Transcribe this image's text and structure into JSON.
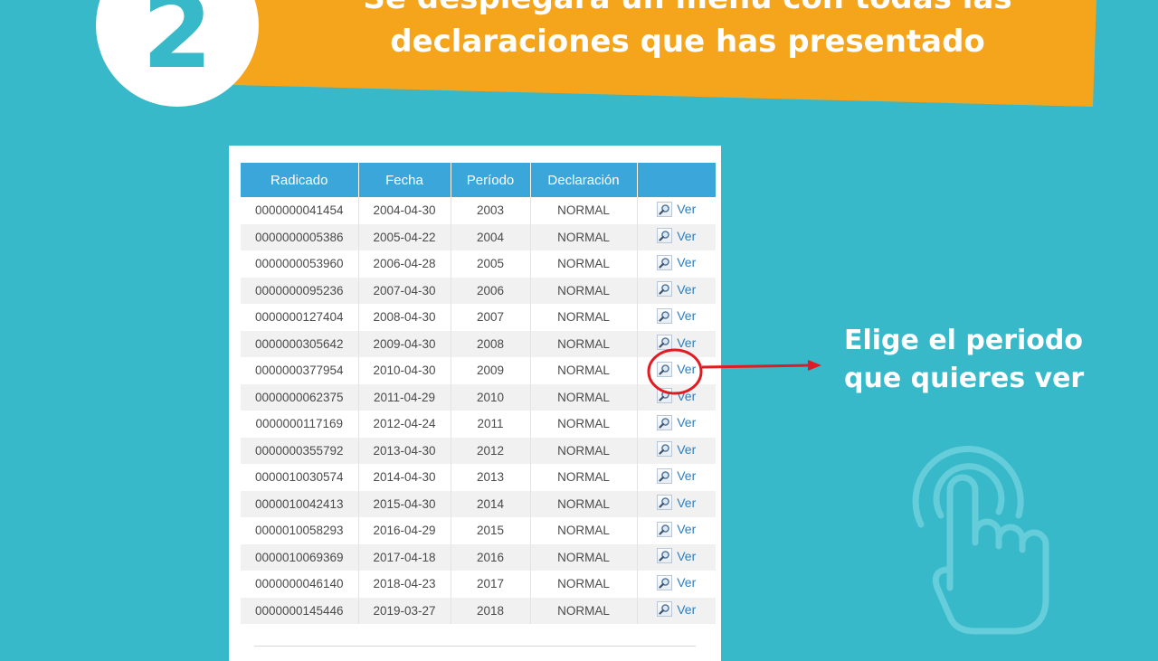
{
  "banner": {
    "line1": "Se desplegará un menú con todas las",
    "line2": "declaraciones que has presentado",
    "step_number": "2",
    "color": "#f5a51c"
  },
  "table": {
    "headers": [
      "Radicado",
      "Fecha",
      "Período",
      "Declaración",
      ""
    ],
    "link_label": "Ver",
    "rows": [
      {
        "radicado": "0000000041454",
        "fecha": "2004-04-30",
        "periodo": "2003",
        "declaracion": "NORMAL"
      },
      {
        "radicado": "0000000005386",
        "fecha": "2005-04-22",
        "periodo": "2004",
        "declaracion": "NORMAL"
      },
      {
        "radicado": "0000000053960",
        "fecha": "2006-04-28",
        "periodo": "2005",
        "declaracion": "NORMAL"
      },
      {
        "radicado": "0000000095236",
        "fecha": "2007-04-30",
        "periodo": "2006",
        "declaracion": "NORMAL"
      },
      {
        "radicado": "0000000127404",
        "fecha": "2008-04-30",
        "periodo": "2007",
        "declaracion": "NORMAL"
      },
      {
        "radicado": "0000000305642",
        "fecha": "2009-04-30",
        "periodo": "2008",
        "declaracion": "NORMAL"
      },
      {
        "radicado": "0000000377954",
        "fecha": "2010-04-30",
        "periodo": "2009",
        "declaracion": "NORMAL"
      },
      {
        "radicado": "0000000062375",
        "fecha": "2011-04-29",
        "periodo": "2010",
        "declaracion": "NORMAL"
      },
      {
        "radicado": "0000000117169",
        "fecha": "2012-04-24",
        "periodo": "2011",
        "declaracion": "NORMAL"
      },
      {
        "radicado": "0000000355792",
        "fecha": "2013-04-30",
        "periodo": "2012",
        "declaracion": "NORMAL"
      },
      {
        "radicado": "0000010030574",
        "fecha": "2014-04-30",
        "periodo": "2013",
        "declaracion": "NORMAL"
      },
      {
        "radicado": "0000010042413",
        "fecha": "2015-04-30",
        "periodo": "2014",
        "declaracion": "NORMAL"
      },
      {
        "radicado": "0000010058293",
        "fecha": "2016-04-29",
        "periodo": "2015",
        "declaracion": "NORMAL"
      },
      {
        "radicado": "0000010069369",
        "fecha": "2017-04-18",
        "periodo": "2016",
        "declaracion": "NORMAL"
      },
      {
        "radicado": "0000000046140",
        "fecha": "2018-04-23",
        "periodo": "2017",
        "declaracion": "NORMAL"
      },
      {
        "radicado": "0000000145446",
        "fecha": "2019-03-27",
        "periodo": "2018",
        "declaracion": "NORMAL"
      }
    ],
    "highlighted_row": 6
  },
  "callout": {
    "line1": "Elige el periodo",
    "line2": "que quieres ver"
  },
  "icons": {
    "row_link_icon": "magnifier-icon",
    "annotation": "red-circle-arrow",
    "decoration": "tap-hand-icon"
  },
  "colors": {
    "background": "#37b9c9",
    "banner": "#f5a51c",
    "header": "#3aa6d9",
    "link": "#2e7fbf",
    "annotation": "#e11b22"
  }
}
